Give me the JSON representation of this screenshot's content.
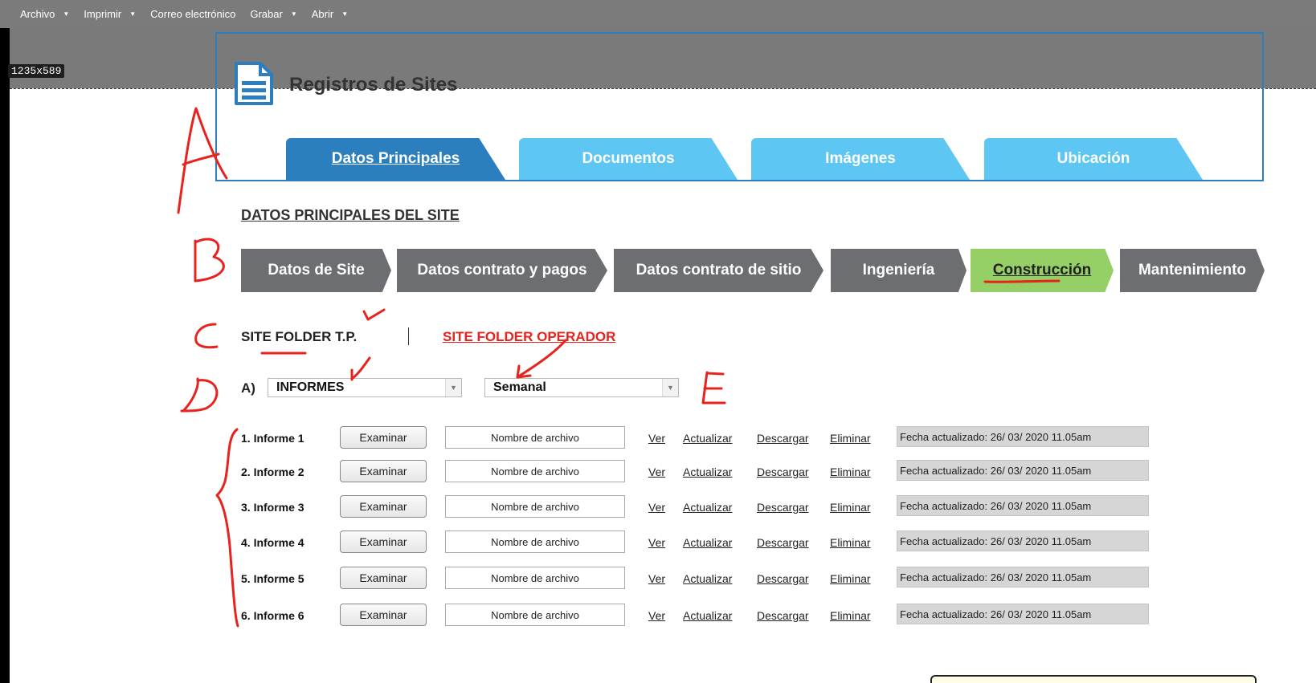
{
  "toolbar": {
    "items": [
      {
        "label": "Archivo"
      },
      {
        "label": "Imprimir"
      },
      {
        "label": "Correo electrónico"
      },
      {
        "label": "Grabar"
      },
      {
        "label": "Abrir"
      }
    ]
  },
  "capture_size": "1235x589",
  "header": {
    "title": "Registros de Sites"
  },
  "tabs": [
    {
      "label": "Datos Principales",
      "active": true
    },
    {
      "label": "Documentos"
    },
    {
      "label": "Imágenes"
    },
    {
      "label": "Ubicación"
    }
  ],
  "section_title": "DATOS PRINCIPALES DEL SITE",
  "steps": [
    {
      "label": "Datos de Site"
    },
    {
      "label": "Datos contrato y pagos"
    },
    {
      "label": "Datos contrato de sitio"
    },
    {
      "label": "Ingeniería"
    },
    {
      "label": "Construcción",
      "active": true
    },
    {
      "label": "Mantenimiento"
    }
  ],
  "site_folder": {
    "tp": "SITE FOLDER T.P.",
    "operador": "SITE FOLDER OPERADOR"
  },
  "filters": {
    "prefix": "A)",
    "type": "INFORMES",
    "period": "Semanal"
  },
  "rows": [
    {
      "label": "1. Informe 1",
      "button": "Examinar",
      "file": "Nombre de archivo",
      "ver": "Ver",
      "actualizar": "Actualizar",
      "descargar": "Descargar",
      "eliminar": "Eliminar",
      "date": "Fecha actualizado: 26/ 03/ 2020  11.05am"
    },
    {
      "label": "2. Informe 2",
      "button": "Examinar",
      "file": "Nombre de archivo",
      "ver": "Ver",
      "actualizar": "Actualizar",
      "descargar": "Descargar",
      "eliminar": "Eliminar",
      "date": "Fecha actualizado: 26/ 03/ 2020  11.05am"
    },
    {
      "label": "3. Informe 3",
      "button": "Examinar",
      "file": "Nombre de archivo",
      "ver": "Ver",
      "actualizar": "Actualizar",
      "descargar": "Descargar",
      "eliminar": "Eliminar",
      "date": "Fecha actualizado: 26/ 03/ 2020  11.05am"
    },
    {
      "label": "4. Informe 4",
      "button": "Examinar",
      "file": "Nombre de archivo",
      "ver": "Ver",
      "actualizar": "Actualizar",
      "descargar": "Descargar",
      "eliminar": "Eliminar",
      "date": "Fecha actualizado: 26/ 03/ 2020  11.05am"
    },
    {
      "label": "5. Informe 5",
      "button": "Examinar",
      "file": "Nombre de archivo",
      "ver": "Ver",
      "actualizar": "Actualizar",
      "descargar": "Descargar",
      "eliminar": "Eliminar",
      "date": "Fecha actualizado: 26/ 03/ 2020  11.05am"
    },
    {
      "label": "6. Informe 6",
      "button": "Examinar",
      "file": "Nombre de archivo",
      "ver": "Ver",
      "actualizar": "Actualizar",
      "descargar": "Descargar",
      "eliminar": "Eliminar",
      "date": "Fecha actualizado: 26/ 03/ 2020  11.05am"
    }
  ],
  "annotations": {
    "letters": [
      "A",
      "B",
      "C",
      "D",
      "E"
    ],
    "color": "#e8221c"
  },
  "colors": {
    "tab_active": "#2b7fbe",
    "tab_light": "#5ec6f2",
    "step": "#6d6e71",
    "step_active": "#95cf66"
  }
}
